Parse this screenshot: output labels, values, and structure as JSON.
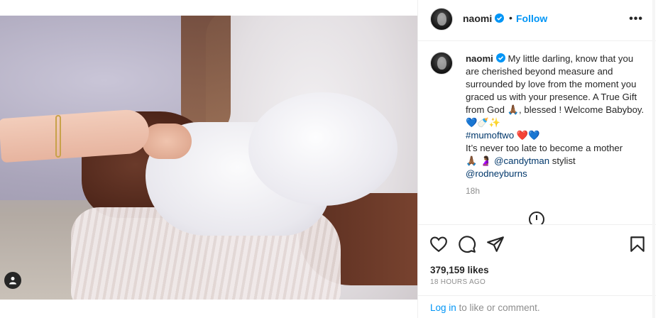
{
  "post": {
    "username": "naomi",
    "follow_label": "Follow",
    "dot": "•",
    "more_label": "•••",
    "caption": {
      "username": "naomi",
      "line1": "My little darling, know that you are cherished beyond measure and surrounded by love from the moment you graced us with your presence. A True Gift from God 🙏🏾, blessed ! Welcome Babyboy. ",
      "emoji1": "💙🍼✨",
      "hashtag": "#mumoftwo",
      "emoji2": " ❤️💙",
      "line2": "It’s never too late to become a mother",
      "line3_prefix": "🙏🏾 🤰🏾 ",
      "mention1": "@candytman",
      "line3_suffix": " stylist",
      "mention2": "@rodneyburns"
    },
    "comment_time": "18h",
    "likes": "379,159 likes",
    "date": "18 HOURS AGO",
    "login": {
      "link": "Log in",
      "rest": " to like or comment."
    }
  },
  "colors": {
    "accent": "#0095f6",
    "link": "#00376b",
    "muted": "#8e8e8e",
    "text": "#262626"
  },
  "icons": {
    "like": "heart-icon",
    "comment": "comment-icon",
    "share": "send-icon",
    "save": "bookmark-icon",
    "tag": "user-tag-icon",
    "verified": "verified-badge-icon",
    "load_more": "plus-circle-icon"
  }
}
